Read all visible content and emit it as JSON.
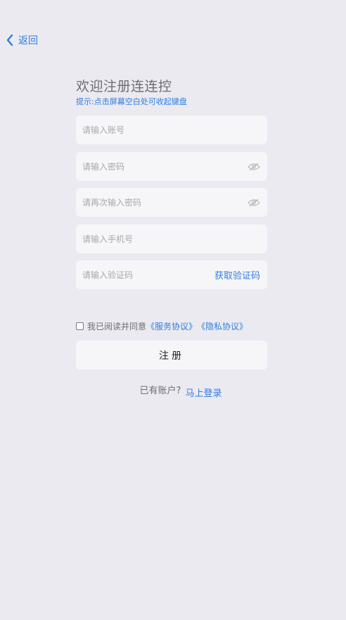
{
  "nav": {
    "back_label": "返回"
  },
  "header": {
    "title": "欢迎注册连连控",
    "hint": "提示:点击屏幕空白处可收起键盘"
  },
  "form": {
    "account_placeholder": "请输入账号",
    "password_placeholder": "请输入密码",
    "confirm_password_placeholder": "请再次输入密码",
    "phone_placeholder": "请输入手机号",
    "code_placeholder": "请输入验证码",
    "get_code_label": "获取验证码"
  },
  "agreement": {
    "checked": false,
    "prefix": "我已阅读并同意",
    "service_link": "《服务协议》",
    "privacy_link": "《隐私协议》"
  },
  "actions": {
    "register_label": "注册"
  },
  "footer": {
    "has_account": "已有账户?",
    "login_link": "马上登录"
  },
  "colors": {
    "accent": "#2F7DE1",
    "background": "#EBEAF0",
    "field_bg": "#F6F6F8"
  },
  "icons": {
    "back": "chevron-left-icon",
    "visibility": "eye-off-icon"
  }
}
